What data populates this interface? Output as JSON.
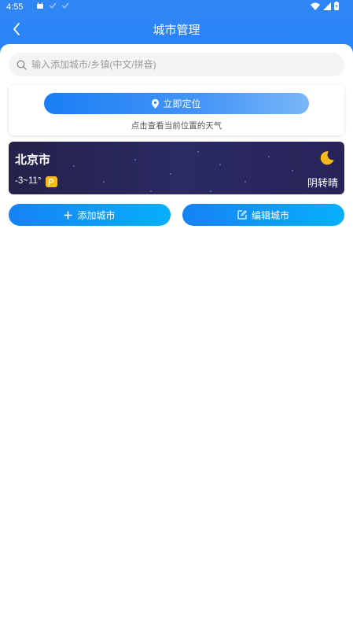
{
  "status_bar": {
    "time": "4:55",
    "notification_icons": [
      "android-icon",
      "check-icon",
      "check-icon"
    ],
    "system_icons": [
      "wifi-icon",
      "signal-icon",
      "battery-icon"
    ]
  },
  "nav": {
    "title": "城市管理",
    "back_icon": "chevron-left-icon"
  },
  "search": {
    "placeholder": "输入添加城市/乡镇(中文/拼音)",
    "value": ""
  },
  "locate": {
    "button_label": "立即定位",
    "hint": "点击查看当前位置的天气"
  },
  "city": {
    "name": "北京市",
    "temp_range": "-3~11°",
    "weather": "阴转晴",
    "weather_icon": "moon-icon",
    "aqi_color": "#f7b91b"
  },
  "actions": {
    "add_label": "添加城市",
    "edit_label": "编辑城市"
  },
  "colors": {
    "accent": "#2a84f5",
    "card_dark": "#28245a",
    "moon": "#f7b91b"
  }
}
